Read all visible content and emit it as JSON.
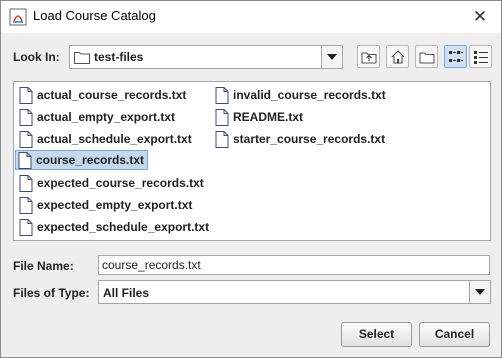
{
  "window": {
    "title": "Load Course Catalog",
    "close_glyph": "✕"
  },
  "look_in": {
    "label": "Look In:",
    "value": "test-files"
  },
  "toolbar": {
    "buttons": [
      {
        "icon": "up-one-level-icon"
      },
      {
        "icon": "home-icon"
      },
      {
        "icon": "new-folder-icon"
      },
      {
        "icon": "list-view-icon",
        "active": true
      },
      {
        "icon": "details-view-icon"
      }
    ]
  },
  "files": [
    {
      "name": "actual_course_records.txt"
    },
    {
      "name": "actual_empty_export.txt"
    },
    {
      "name": "actual_schedule_export.txt"
    },
    {
      "name": "course_records.txt",
      "selected": true
    },
    {
      "name": "expected_course_records.txt"
    },
    {
      "name": "expected_empty_export.txt"
    },
    {
      "name": "expected_schedule_export.txt"
    },
    {
      "name": "invalid_course_records.txt"
    },
    {
      "name": "README.txt"
    },
    {
      "name": "starter_course_records.txt"
    }
  ],
  "file_name": {
    "label": "File Name:",
    "value": "course_records.txt"
  },
  "files_of_type": {
    "label": "Files of Type:",
    "value": "All Files"
  },
  "actions": {
    "select_label": "Select",
    "cancel_label": "Cancel"
  },
  "colors": {
    "selection": "#c6d8ee",
    "selection_border": "#7ea6d4",
    "dialog_bg": "#eeeeee"
  }
}
